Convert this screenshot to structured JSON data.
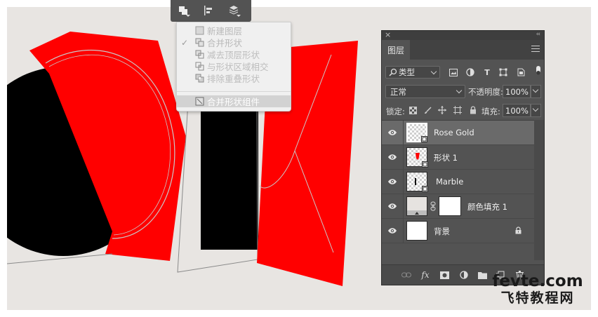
{
  "colors": {
    "canvas_bg": "#e8e5e2",
    "shape_red": "#ff0000",
    "shape_black": "#000000",
    "panel_bg": "#535353",
    "menu_bg": "#f0f0f0"
  },
  "path_operations_menu": {
    "items": [
      {
        "label": "新建图层",
        "icon": "new-layer-icon",
        "checked": false,
        "state": "disabled"
      },
      {
        "label": "合并形状",
        "icon": "combine-shapes-icon",
        "checked": true,
        "state": "active"
      },
      {
        "label": "减去顶层形状",
        "icon": "subtract-front-shape-icon",
        "checked": false,
        "state": "normal"
      },
      {
        "label": "与形状区域相交",
        "icon": "intersect-shape-areas-icon",
        "checked": false,
        "state": "normal"
      },
      {
        "label": "排除重叠形状",
        "icon": "exclude-overlapping-shapes-icon",
        "checked": false,
        "state": "normal"
      },
      {
        "label": "合并形状组件",
        "icon": "merge-shape-components-icon",
        "checked": false,
        "state": "highlighted"
      }
    ]
  },
  "layers_panel": {
    "close": "×",
    "collapse": "‹‹",
    "tab": "图层",
    "filter": {
      "label": "类型",
      "search_icon": "search-icon"
    },
    "filter_icons": [
      "pixel-filter-icon",
      "adjustment-filter-icon",
      "type-filter-icon",
      "shape-filter-icon",
      "smart-object-filter-icon"
    ],
    "type_filter_glyph": "T",
    "blend_mode": "正常",
    "opacity_label": "不透明度:",
    "opacity_value": "100%",
    "lock_label": "锁定:",
    "lock_icons": [
      "lock-transparent-icon",
      "lock-image-icon",
      "lock-position-icon",
      "lock-artboard-icon",
      "lock-all-icon"
    ],
    "fill_label": "填充:",
    "fill_value": "100%",
    "layers": [
      {
        "name": "Rose Gold",
        "visible": true,
        "selected": true,
        "thumb": "transparent",
        "type": "shape"
      },
      {
        "name": "形状 1",
        "visible": true,
        "selected": false,
        "thumb": "transparent",
        "type": "shape"
      },
      {
        "name": "Marble",
        "visible": true,
        "selected": false,
        "thumb": "transparent",
        "type": "shape"
      },
      {
        "name": "颜色填充 1",
        "visible": true,
        "selected": false,
        "thumb": "fill",
        "type": "fill",
        "has_mask": true
      },
      {
        "name": "背景",
        "visible": true,
        "selected": false,
        "thumb": "white",
        "type": "background",
        "locked": true
      }
    ],
    "footer_icons": [
      "link-layers-icon",
      "fx-icon",
      "add-mask-icon",
      "adjustment-layer-icon",
      "new-group-icon",
      "new-layer-icon",
      "delete-icon"
    ],
    "fx_label": "fx"
  },
  "watermark": {
    "site": "fevte.com",
    "cn": "飞特教程网"
  }
}
